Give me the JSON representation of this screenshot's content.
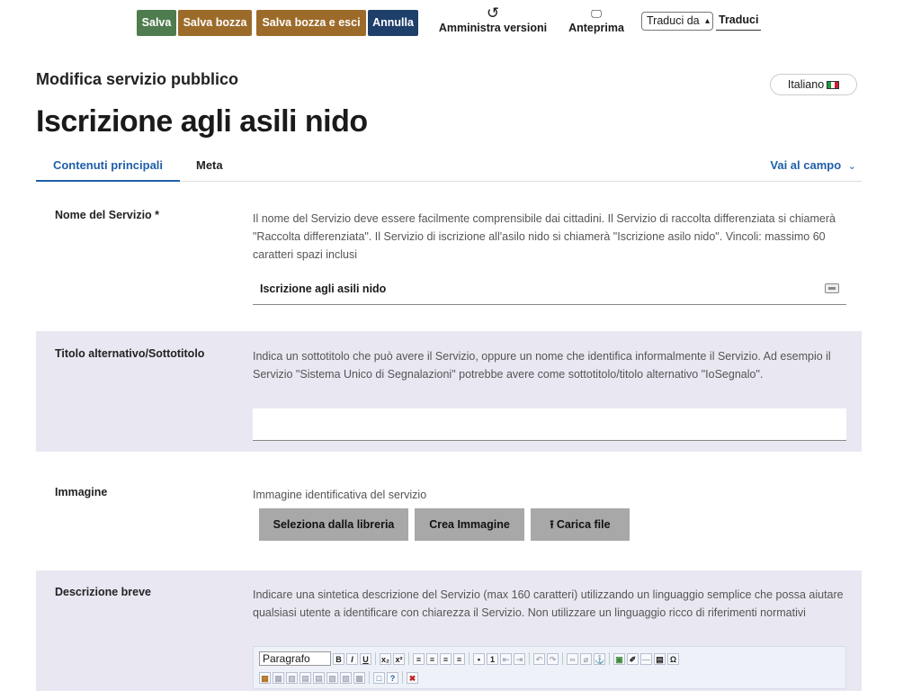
{
  "toolbar": {
    "save": "Salva",
    "save_draft": "Salva bozza",
    "save_draft_exit": "Salva bozza e esci",
    "cancel": "Annulla",
    "versions": "Amministra versioni",
    "versions_icon": "history-icon",
    "preview": "Anteprima",
    "preview_icon": "preview-icon",
    "translate_from": "Traduci da",
    "translate": "Traduci",
    "colors": {
      "save": "#4f7c4f",
      "draft": "#9c6b2a",
      "cancel": "#1f3f6b"
    }
  },
  "header": {
    "subtitle": "Modifica servizio pubblico",
    "language": "Italiano",
    "title": "Iscrizione agli asili nido"
  },
  "tabs": {
    "main": "Contenuti principali",
    "meta": "Meta",
    "goto": "Vai al campo"
  },
  "fields": {
    "name": {
      "label": "Nome del Servizio *",
      "help": "Il nome del Servizio deve essere facilmente comprensibile dai cittadini. Il Servizio di raccolta differenziata si chiamerà \"Raccolta differenziata\". Il Servizio di iscrizione all'asilo nido si chiamerà \"Iscrizione asilo nido\". Vincoli: massimo 60 caratteri spazi inclusi",
      "value": "Iscrizione agli asili nido"
    },
    "alt_title": {
      "label": "Titolo alternativo/Sottotitolo",
      "help": "Indica un sottotitolo che può avere il Servizio, oppure un nome che identifica informalmente il Servizio. Ad esempio il Servizio \"Sistema Unico di Segnalazioni\" potrebbe avere come sottotitolo/titolo alternativo \"IoSegnalo\".",
      "value": ""
    },
    "image": {
      "label": "Immagine",
      "help": "Immagine identificativa del servizio",
      "select_library": "Seleziona dalla libreria",
      "create_image": "Crea Immagine",
      "upload": "Carica file"
    },
    "short_desc": {
      "label": "Descrizione breve",
      "help": "Indicare una sintetica descrizione del Servizio (max 160 caratteri) utilizzando un linguaggio semplice che possa aiutare qualsiasi utente a identificare con chiarezza il Servizio. Non utilizzare un linguaggio ricco di riferimenti normativi",
      "format": "Paragrafo"
    }
  }
}
